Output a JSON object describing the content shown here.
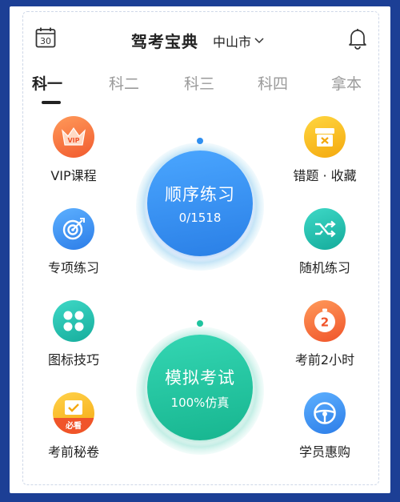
{
  "header": {
    "calendar_day": "30",
    "title": "驾考宝典",
    "city": "中山市",
    "city_chevron": "chevron-down-icon",
    "bell": "bell-icon"
  },
  "tabs": [
    {
      "label": "科一",
      "active": true
    },
    {
      "label": "科二",
      "active": false
    },
    {
      "label": "科三",
      "active": false
    },
    {
      "label": "科四",
      "active": false
    },
    {
      "label": "拿本",
      "active": false
    }
  ],
  "left_items": [
    {
      "label": "VIP课程",
      "icon": "vip-crown-icon",
      "badge": "VIP",
      "color": "#f26a3b"
    },
    {
      "label": "专项练习",
      "icon": "target-icon",
      "color": "#3a8ff0"
    },
    {
      "label": "图标技巧",
      "icon": "grid-dots-icon",
      "color": "#25c0b0"
    },
    {
      "label": "考前秘卷",
      "icon": "exam-paper-icon",
      "badge": "必看",
      "color": "#f6b21a"
    }
  ],
  "right_items": [
    {
      "label": "错题 · 收藏",
      "icon": "box-icon",
      "color": "#f7b51e"
    },
    {
      "label": "随机练习",
      "icon": "shuffle-icon",
      "color": "#23bfae"
    },
    {
      "label": "考前2小时",
      "icon": "timer-icon",
      "badge": "2",
      "color": "#f26a3b"
    },
    {
      "label": "学员惠购",
      "icon": "steering-wheel-icon",
      "color": "#3a8ff0"
    }
  ],
  "center": {
    "sequential": {
      "title": "顺序练习",
      "progress": "0/1518",
      "color": "#2f8ff0"
    },
    "mock": {
      "title": "模拟考试",
      "subtitle": "100%仿真",
      "color": "#1fc49f"
    }
  }
}
